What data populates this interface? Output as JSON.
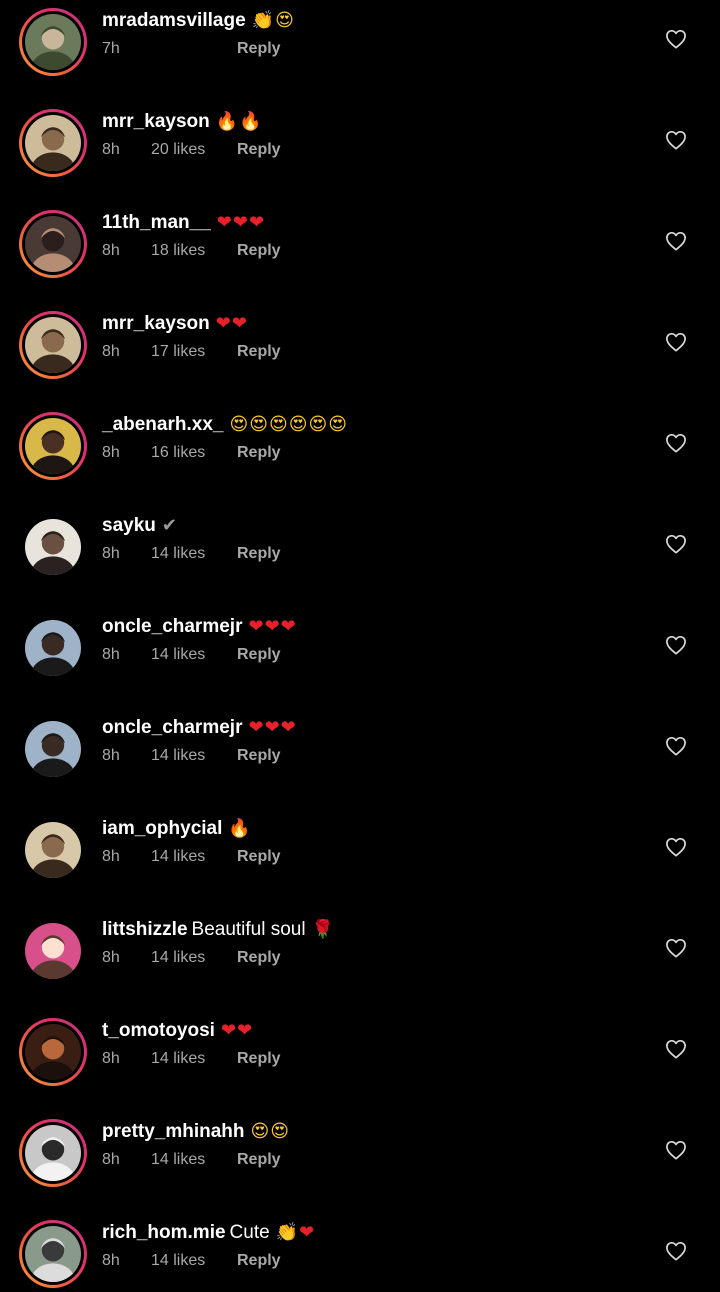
{
  "colors": {
    "background": "#000000",
    "text_primary": "#ffffff",
    "text_secondary": "#a8a8a8",
    "story_ring_start": "#f9a03f",
    "story_ring_end": "#c13584"
  },
  "comments": [
    {
      "username": "mradamsvillage",
      "text": "",
      "emoji": "👏😍",
      "time": "7h",
      "likes": "",
      "reply": "Reply",
      "has_ring": true,
      "avatar": "avatar-photo"
    },
    {
      "username": "mrr_kayson",
      "text": "",
      "emoji": "🔥🔥",
      "time": "8h",
      "likes": "20 likes",
      "reply": "Reply",
      "has_ring": true,
      "avatar": "avatar-photo"
    },
    {
      "username": "11th_man__",
      "text": "",
      "emoji": "❤❤❤",
      "time": "8h",
      "likes": "18 likes",
      "reply": "Reply",
      "has_ring": true,
      "avatar": "avatar-photo"
    },
    {
      "username": "mrr_kayson",
      "text": "",
      "emoji": "❤❤",
      "time": "8h",
      "likes": "17 likes",
      "reply": "Reply",
      "has_ring": true,
      "avatar": "avatar-photo"
    },
    {
      "username": "_abenarh.xx_",
      "text": "",
      "emoji": "😍😍😍😍😍😍",
      "time": "8h",
      "likes": "16 likes",
      "reply": "Reply",
      "has_ring": true,
      "avatar": "avatar-photo"
    },
    {
      "username": "sayku",
      "text": "",
      "emoji": "✔",
      "time": "8h",
      "likes": "14 likes",
      "reply": "Reply",
      "has_ring": false,
      "avatar": "avatar-photo"
    },
    {
      "username": "oncle_charmejr",
      "text": "",
      "emoji": "❤❤❤",
      "time": "8h",
      "likes": "14 likes",
      "reply": "Reply",
      "has_ring": false,
      "avatar": "avatar-photo"
    },
    {
      "username": "oncle_charmejr",
      "text": "",
      "emoji": "❤❤❤",
      "time": "8h",
      "likes": "14 likes",
      "reply": "Reply",
      "has_ring": false,
      "avatar": "avatar-photo"
    },
    {
      "username": "iam_ophycial",
      "text": "",
      "emoji": "🔥",
      "time": "8h",
      "likes": "14 likes",
      "reply": "Reply",
      "has_ring": false,
      "avatar": "avatar-photo"
    },
    {
      "username": "littshizzle",
      "text": "Beautiful soul",
      "emoji": "🌹",
      "time": "8h",
      "likes": "14 likes",
      "reply": "Reply",
      "has_ring": false,
      "avatar": "avatar-photo"
    },
    {
      "username": "t_omotoyosi",
      "text": "",
      "emoji": "❤❤",
      "time": "8h",
      "likes": "14 likes",
      "reply": "Reply",
      "has_ring": true,
      "avatar": "avatar-photo"
    },
    {
      "username": "pretty_mhinahh",
      "text": "",
      "emoji": "😍😍",
      "time": "8h",
      "likes": "14 likes",
      "reply": "Reply",
      "has_ring": true,
      "avatar": "avatar-photo"
    },
    {
      "username": "rich_hom.mie",
      "text": "Cute",
      "emoji": "👏❤",
      "time": "8h",
      "likes": "14 likes",
      "reply": "Reply",
      "has_ring": true,
      "avatar": "avatar-photo"
    }
  ],
  "icons": {
    "like": "heart-outline-icon"
  }
}
